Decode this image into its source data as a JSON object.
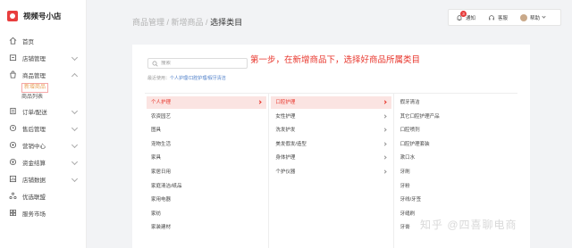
{
  "app": {
    "title": "视频号小店"
  },
  "sidebar": {
    "items": [
      {
        "label": "首页",
        "icon": "home-icon"
      },
      {
        "label": "店铺管理",
        "icon": "store-icon",
        "chevron": "down"
      },
      {
        "label": "商品管理",
        "icon": "bag-icon",
        "chevron": "up",
        "children": [
          {
            "label": "新增商品",
            "active": true
          },
          {
            "label": "商品列表"
          }
        ]
      },
      {
        "label": "订单/配送",
        "icon": "order-icon",
        "chevron": "down"
      },
      {
        "label": "售后管理",
        "icon": "after-sale-icon",
        "chevron": "down"
      },
      {
        "label": "营销中心",
        "icon": "marketing-icon",
        "chevron": "down"
      },
      {
        "label": "资金结算",
        "icon": "funds-icon",
        "chevron": "down"
      },
      {
        "label": "店铺数据",
        "icon": "data-icon",
        "chevron": "down"
      },
      {
        "label": "优选联盟",
        "icon": "alliance-icon"
      },
      {
        "label": "服务市场",
        "icon": "market-icon"
      }
    ]
  },
  "breadcrumb": {
    "part1": "商品管理",
    "sep": " / ",
    "part2": "新增商品",
    "current": "选择类目"
  },
  "topbar": {
    "notify_label": "通知",
    "notify_badge": "3",
    "user_label": "客服",
    "help_label": "帮助"
  },
  "annotation": "第一步，在新增商品下，选择好商品所属类目",
  "search": {
    "placeholder": "搜索"
  },
  "recent": {
    "label": "最近使用：",
    "path": "个人护理/口腔护理/假牙清洁"
  },
  "columns": [
    {
      "items": [
        {
          "label": "个人护理",
          "selected": true,
          "arrow": true
        },
        {
          "label": "农资园艺"
        },
        {
          "label": "图具"
        },
        {
          "label": "宠物生活"
        },
        {
          "label": "家具"
        },
        {
          "label": "家居日用"
        },
        {
          "label": "家庭清洁/纸品"
        },
        {
          "label": "家用电器"
        },
        {
          "label": "家纺"
        },
        {
          "label": "家装建材"
        }
      ]
    },
    {
      "items": [
        {
          "label": "口腔护理",
          "selected": true,
          "arrow": true
        },
        {
          "label": "女性护理",
          "arrow": true
        },
        {
          "label": "洗发护发",
          "arrow": true
        },
        {
          "label": "美发假发/造型",
          "arrow": true
        },
        {
          "label": "身体护理",
          "arrow": true
        },
        {
          "label": "个护仪器",
          "arrow": true
        }
      ]
    },
    {
      "items": [
        {
          "label": "假牙清洁"
        },
        {
          "label": "其它口腔护理产品"
        },
        {
          "label": "口腔喷剂"
        },
        {
          "label": "口腔护理套装"
        },
        {
          "label": "漱口水"
        },
        {
          "label": "牙刷"
        },
        {
          "label": "牙粉"
        },
        {
          "label": "牙线/牙签"
        },
        {
          "label": "牙缝刷"
        },
        {
          "label": "牙膏"
        }
      ]
    }
  ],
  "watermark": "知乎 @四喜聊电商",
  "colors": {
    "accent": "#e8362c",
    "selected_bg": "#fbe4e2",
    "link": "#4a7cc7",
    "background": "#f2f3f5"
  }
}
